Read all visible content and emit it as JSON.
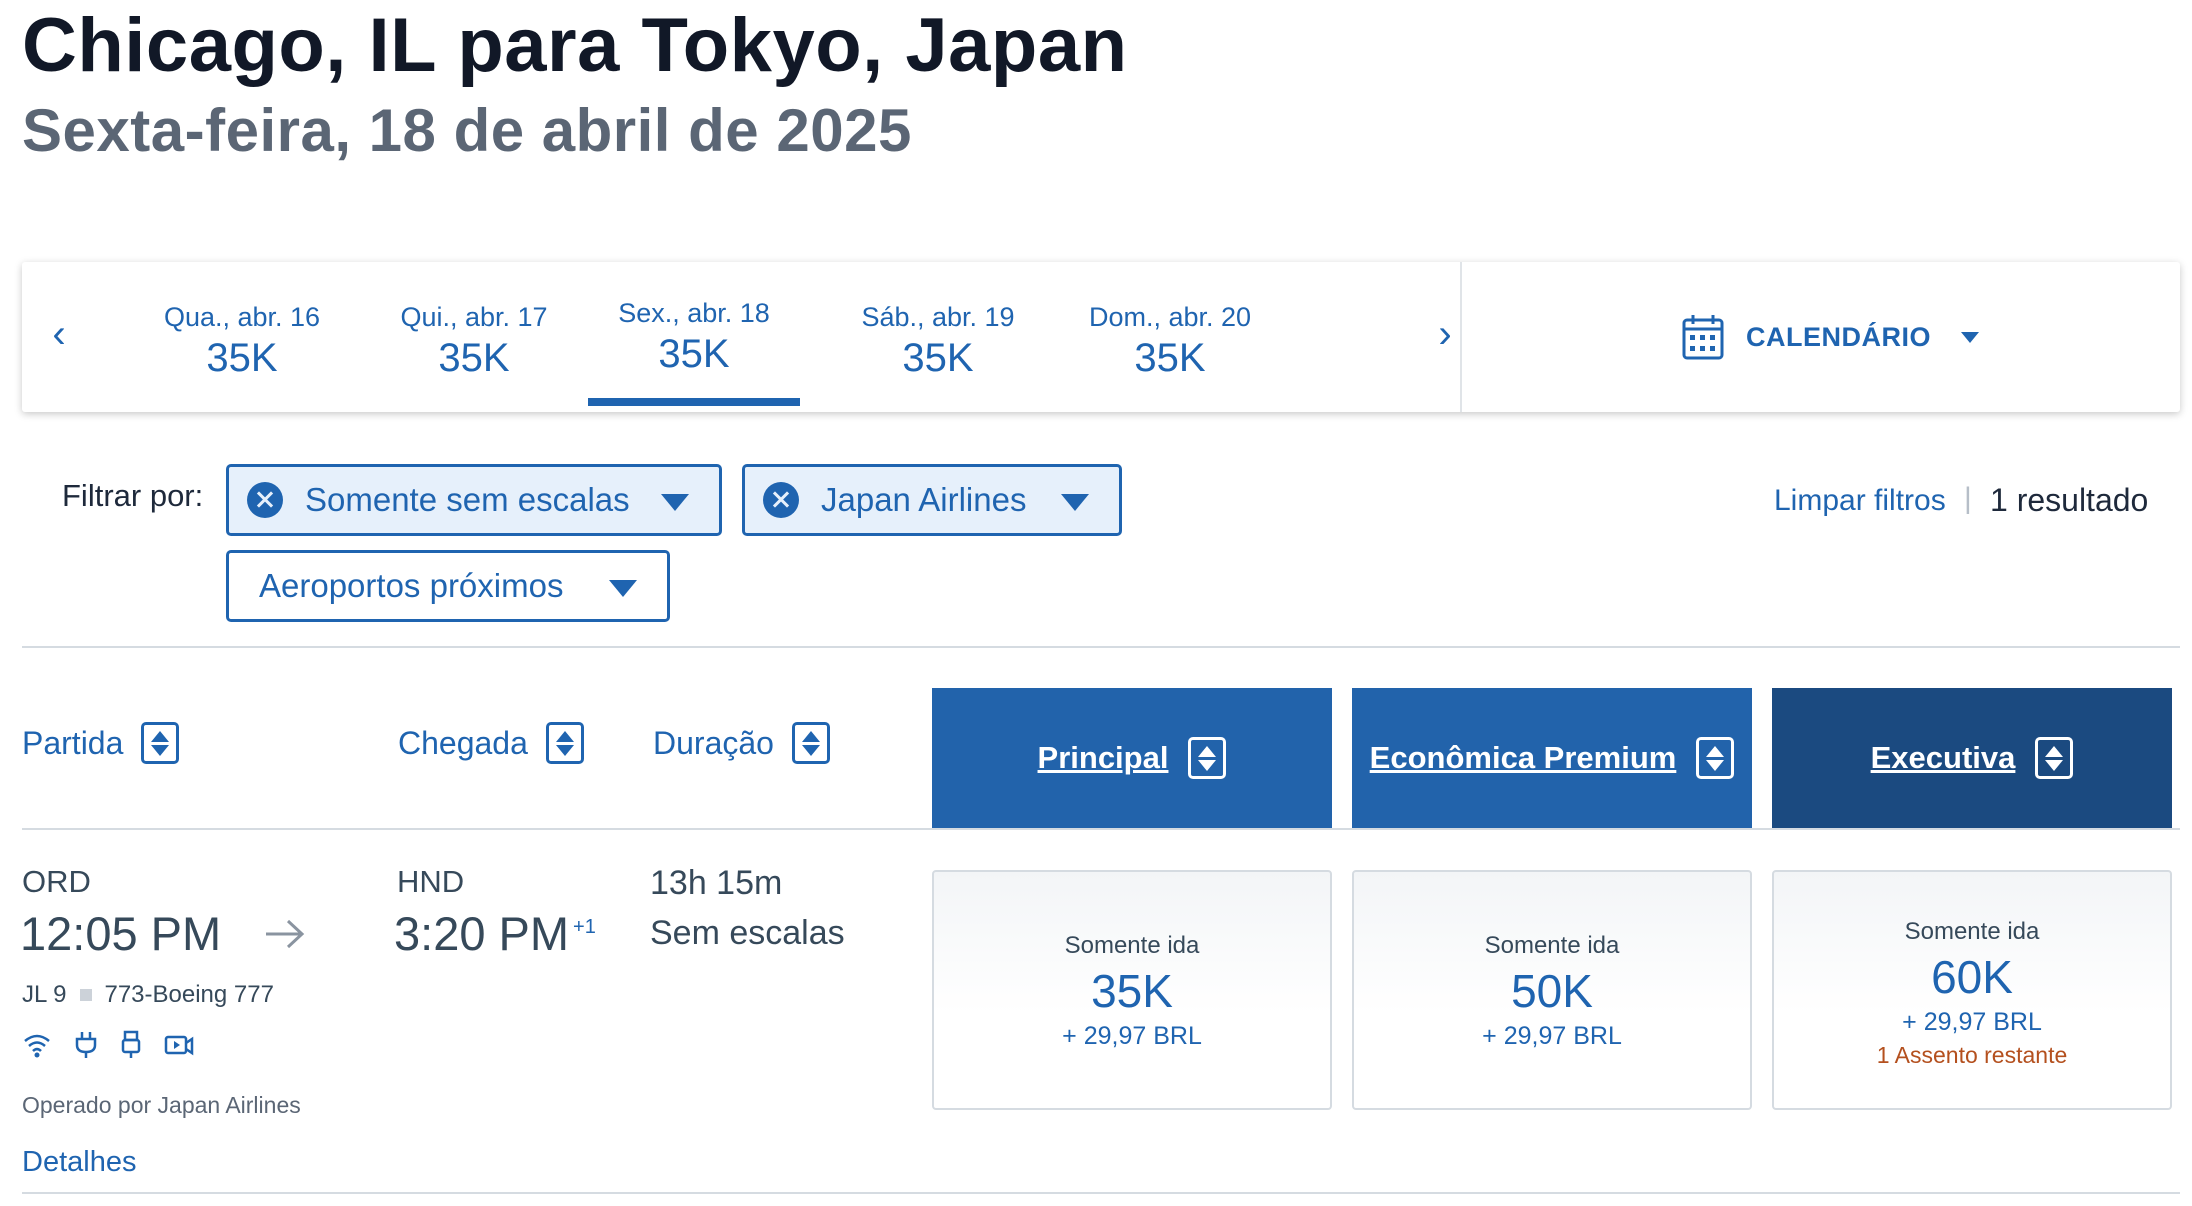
{
  "header": {
    "route": "Chicago, IL para Tokyo, Japan",
    "date": "Sexta-feira, 18 de abril de 2025"
  },
  "date_strip": {
    "prev_icon": "chevron-left-icon",
    "next_icon": "chevron-right-icon",
    "prev_glyph": "‹",
    "next_glyph": "›",
    "days": [
      {
        "label": "Qua., abr. 16",
        "price": "35K",
        "selected": false
      },
      {
        "label": "Qui., abr. 17",
        "price": "35K",
        "selected": false
      },
      {
        "label": "Sex., abr. 18",
        "price": "35K",
        "selected": true
      },
      {
        "label": "Sáb., abr. 19",
        "price": "35K",
        "selected": false
      },
      {
        "label": "Dom., abr. 20",
        "price": "35K",
        "selected": false
      }
    ],
    "calendar_label": "CALENDÁRIO",
    "calendar_icon": "calendar-icon"
  },
  "filters": {
    "label": "Filtrar por:",
    "chips": [
      {
        "label": "Somente sem escalas",
        "active": true
      },
      {
        "label": "Japan Airlines",
        "active": true
      },
      {
        "label": "Aeroportos próximos",
        "active": false
      }
    ],
    "clear_label": "Limpar filtros",
    "separator": "|",
    "result_count": "1 resultado"
  },
  "columns": {
    "departure": "Partida",
    "arrival": "Chegada",
    "duration": "Duração",
    "cabins": [
      {
        "label": "Principal",
        "color": "#2263ab"
      },
      {
        "label": "Econômica Premium",
        "color": "#2263ab"
      },
      {
        "label": "Executiva",
        "color": "#1b4a80"
      }
    ]
  },
  "flight": {
    "origin": "ORD",
    "depart_time": "12:05 PM",
    "destination": "HND",
    "arrive_time": "3:20 PM",
    "day_offset": "+1",
    "duration": "13h 15m",
    "stops": "Sem escalas",
    "flight_number": "JL 9",
    "aircraft": "773-Boeing 777",
    "amenities": [
      "wifi-icon",
      "power-outlet-icon",
      "usb-icon",
      "entertainment-icon"
    ],
    "operated_by": "Operado por Japan Airlines",
    "details_label": "Detalhes",
    "fares": [
      {
        "label": "Somente ida",
        "miles": "35K",
        "taxes": "+ 29,97 BRL",
        "seats_left": ""
      },
      {
        "label": "Somente ida",
        "miles": "50K",
        "taxes": "+ 29,97 BRL",
        "seats_left": ""
      },
      {
        "label": "Somente ida",
        "miles": "60K",
        "taxes": "+ 29,97 BRL",
        "seats_left": "1 Assento restante"
      }
    ]
  },
  "colors": {
    "accent": "#1f64b0",
    "cabin_main": "#2263ab",
    "cabin_business": "#1b4a80",
    "warning": "#b4501e"
  }
}
